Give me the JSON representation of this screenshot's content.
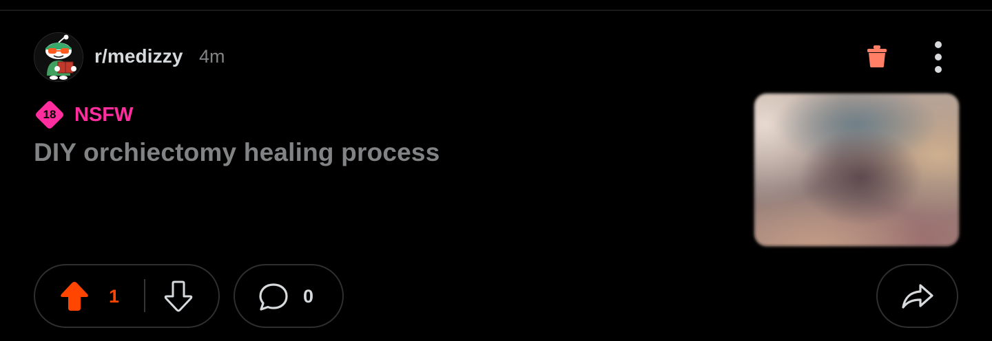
{
  "post": {
    "subreddit": "r/medizzy",
    "time": "4m",
    "nsfw_badge": "18",
    "nsfw_label": "NSFW",
    "title": "DIY orchiectomy healing process",
    "vote_count": "1",
    "comment_count": "0"
  },
  "icons": {
    "avatar": "reddit-snoo-avatar",
    "trash": "trash-icon",
    "more": "more-vertical-icon",
    "upvote": "upvote-arrow-icon",
    "downvote": "downvote-arrow-icon",
    "comment": "comment-bubble-icon",
    "share": "share-arrow-icon"
  },
  "colors": {
    "background": "#000000",
    "subreddit": "#d7dadc",
    "time": "#818384",
    "nsfw": "#ff2d9e",
    "title": "#818384",
    "upvote_active": "#ff4500",
    "trash": "#ff7f66",
    "pill_border": "#2f2f31"
  }
}
